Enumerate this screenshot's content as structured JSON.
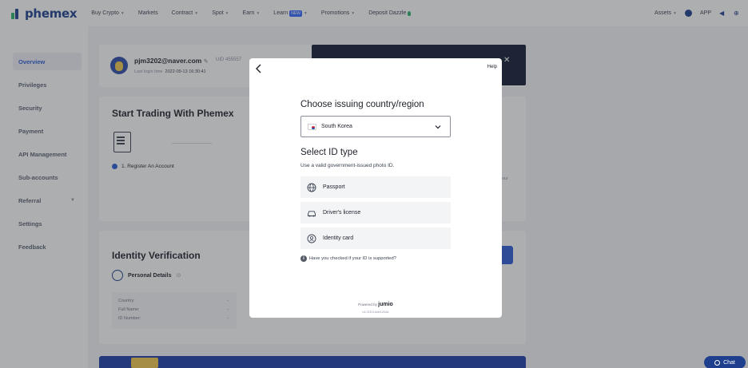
{
  "app": {
    "logo": "phemex"
  },
  "nav": {
    "items": [
      {
        "label": "Buy Crypto",
        "caret": true
      },
      {
        "label": "Markets",
        "caret": false
      },
      {
        "label": "Contract",
        "caret": true
      },
      {
        "label": "Spot",
        "caret": true
      },
      {
        "label": "Earn",
        "caret": true
      },
      {
        "label": "Learn",
        "badge": "NEW",
        "caret": true
      },
      {
        "label": "Promotions",
        "caret": true
      },
      {
        "label": "Deposit Dazzle",
        "caret": false
      }
    ],
    "assets_label": "Assets",
    "app_label": "APP",
    "icons": [
      "user-icon",
      "speaker-icon",
      "globe-icon"
    ]
  },
  "sidebar": {
    "items": [
      {
        "label": "Overview",
        "active": true
      },
      {
        "label": "Privileges"
      },
      {
        "label": "Security"
      },
      {
        "label": "Payment"
      },
      {
        "label": "API Management"
      },
      {
        "label": "Sub-accounts"
      },
      {
        "label": "Referral",
        "caret": true
      },
      {
        "label": "Settings"
      },
      {
        "label": "Feedback"
      }
    ]
  },
  "profile": {
    "email": "pjm3202@naver.com",
    "uid": "UID 455557",
    "last_login_label": "Last login time",
    "last_login_value": "2022-09-13 16:30:41"
  },
  "trading": {
    "title": "Start Trading With Phemex",
    "step1": "1. Register An Account",
    "partial_text": "our"
  },
  "identity": {
    "title": "Identity Verification",
    "personal_details": "Personal Details",
    "rows": [
      {
        "label": "Country:",
        "value": "-"
      },
      {
        "label": "Full Name:",
        "value": "-"
      },
      {
        "label": "ID Number:",
        "value": "-"
      }
    ]
  },
  "chat": {
    "label": "Chat"
  },
  "modal": {
    "help": "Help",
    "country_title": "Choose issuing country/region",
    "country_value": "South Korea",
    "id_type_title": "Select ID type",
    "id_type_sub": "Use a valid government-issued photo ID.",
    "options": [
      {
        "label": "Passport",
        "icon": "globe-icon"
      },
      {
        "label": "Driver's license",
        "icon": "car-icon"
      },
      {
        "label": "Identity card",
        "icon": "id-card-icon"
      }
    ],
    "check_note": "Have you checked if your ID is supported?",
    "powered_by": "Powered by",
    "powered_brand": "jumio",
    "version": "v4.215.0-6de1224A"
  },
  "colors": {
    "brand": "#1d3f8e",
    "accent": "#2c5bd6",
    "active_bg": "#eef1f7"
  }
}
